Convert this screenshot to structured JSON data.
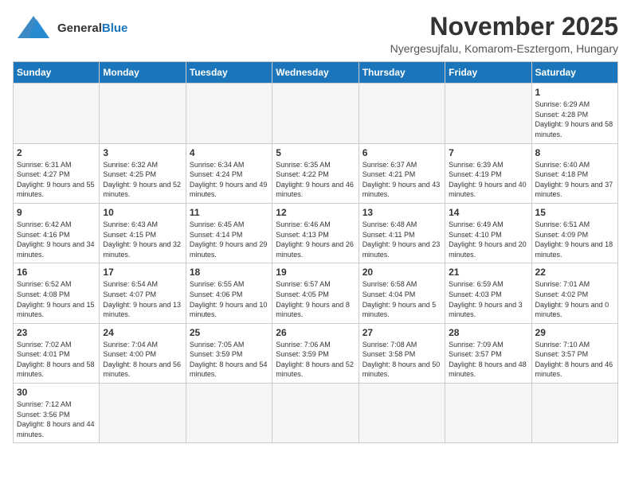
{
  "header": {
    "logo_general": "General",
    "logo_blue": "Blue",
    "month_title": "November 2025",
    "location": "Nyergesujfalu, Komarom-Esztergom, Hungary"
  },
  "weekdays": [
    "Sunday",
    "Monday",
    "Tuesday",
    "Wednesday",
    "Thursday",
    "Friday",
    "Saturday"
  ],
  "days": [
    {
      "date": "",
      "empty": true
    },
    {
      "date": "",
      "empty": true
    },
    {
      "date": "",
      "empty": true
    },
    {
      "date": "",
      "empty": true
    },
    {
      "date": "",
      "empty": true
    },
    {
      "date": "",
      "empty": true
    },
    {
      "date": "1",
      "sunrise": "6:29 AM",
      "sunset": "4:28 PM",
      "daylight": "9 hours and 58 minutes."
    },
    {
      "date": "2",
      "sunrise": "6:31 AM",
      "sunset": "4:27 PM",
      "daylight": "9 hours and 55 minutes."
    },
    {
      "date": "3",
      "sunrise": "6:32 AM",
      "sunset": "4:25 PM",
      "daylight": "9 hours and 52 minutes."
    },
    {
      "date": "4",
      "sunrise": "6:34 AM",
      "sunset": "4:24 PM",
      "daylight": "9 hours and 49 minutes."
    },
    {
      "date": "5",
      "sunrise": "6:35 AM",
      "sunset": "4:22 PM",
      "daylight": "9 hours and 46 minutes."
    },
    {
      "date": "6",
      "sunrise": "6:37 AM",
      "sunset": "4:21 PM",
      "daylight": "9 hours and 43 minutes."
    },
    {
      "date": "7",
      "sunrise": "6:39 AM",
      "sunset": "4:19 PM",
      "daylight": "9 hours and 40 minutes."
    },
    {
      "date": "8",
      "sunrise": "6:40 AM",
      "sunset": "4:18 PM",
      "daylight": "9 hours and 37 minutes."
    },
    {
      "date": "9",
      "sunrise": "6:42 AM",
      "sunset": "4:16 PM",
      "daylight": "9 hours and 34 minutes."
    },
    {
      "date": "10",
      "sunrise": "6:43 AM",
      "sunset": "4:15 PM",
      "daylight": "9 hours and 32 minutes."
    },
    {
      "date": "11",
      "sunrise": "6:45 AM",
      "sunset": "4:14 PM",
      "daylight": "9 hours and 29 minutes."
    },
    {
      "date": "12",
      "sunrise": "6:46 AM",
      "sunset": "4:13 PM",
      "daylight": "9 hours and 26 minutes."
    },
    {
      "date": "13",
      "sunrise": "6:48 AM",
      "sunset": "4:11 PM",
      "daylight": "9 hours and 23 minutes."
    },
    {
      "date": "14",
      "sunrise": "6:49 AM",
      "sunset": "4:10 PM",
      "daylight": "9 hours and 20 minutes."
    },
    {
      "date": "15",
      "sunrise": "6:51 AM",
      "sunset": "4:09 PM",
      "daylight": "9 hours and 18 minutes."
    },
    {
      "date": "16",
      "sunrise": "6:52 AM",
      "sunset": "4:08 PM",
      "daylight": "9 hours and 15 minutes."
    },
    {
      "date": "17",
      "sunrise": "6:54 AM",
      "sunset": "4:07 PM",
      "daylight": "9 hours and 13 minutes."
    },
    {
      "date": "18",
      "sunrise": "6:55 AM",
      "sunset": "4:06 PM",
      "daylight": "9 hours and 10 minutes."
    },
    {
      "date": "19",
      "sunrise": "6:57 AM",
      "sunset": "4:05 PM",
      "daylight": "9 hours and 8 minutes."
    },
    {
      "date": "20",
      "sunrise": "6:58 AM",
      "sunset": "4:04 PM",
      "daylight": "9 hours and 5 minutes."
    },
    {
      "date": "21",
      "sunrise": "6:59 AM",
      "sunset": "4:03 PM",
      "daylight": "9 hours and 3 minutes."
    },
    {
      "date": "22",
      "sunrise": "7:01 AM",
      "sunset": "4:02 PM",
      "daylight": "9 hours and 0 minutes."
    },
    {
      "date": "23",
      "sunrise": "7:02 AM",
      "sunset": "4:01 PM",
      "daylight": "8 hours and 58 minutes."
    },
    {
      "date": "24",
      "sunrise": "7:04 AM",
      "sunset": "4:00 PM",
      "daylight": "8 hours and 56 minutes."
    },
    {
      "date": "25",
      "sunrise": "7:05 AM",
      "sunset": "3:59 PM",
      "daylight": "8 hours and 54 minutes."
    },
    {
      "date": "26",
      "sunrise": "7:06 AM",
      "sunset": "3:59 PM",
      "daylight": "8 hours and 52 minutes."
    },
    {
      "date": "27",
      "sunrise": "7:08 AM",
      "sunset": "3:58 PM",
      "daylight": "8 hours and 50 minutes."
    },
    {
      "date": "28",
      "sunrise": "7:09 AM",
      "sunset": "3:57 PM",
      "daylight": "8 hours and 48 minutes."
    },
    {
      "date": "29",
      "sunrise": "7:10 AM",
      "sunset": "3:57 PM",
      "daylight": "8 hours and 46 minutes."
    },
    {
      "date": "30",
      "sunrise": "7:12 AM",
      "sunset": "3:56 PM",
      "daylight": "8 hours and 44 minutes."
    },
    {
      "date": "",
      "empty": true
    },
    {
      "date": "",
      "empty": true
    },
    {
      "date": "",
      "empty": true
    },
    {
      "date": "",
      "empty": true
    },
    {
      "date": "",
      "empty": true
    },
    {
      "date": "",
      "empty": true
    }
  ],
  "labels": {
    "sunrise": "Sunrise:",
    "sunset": "Sunset:",
    "daylight": "Daylight:"
  }
}
